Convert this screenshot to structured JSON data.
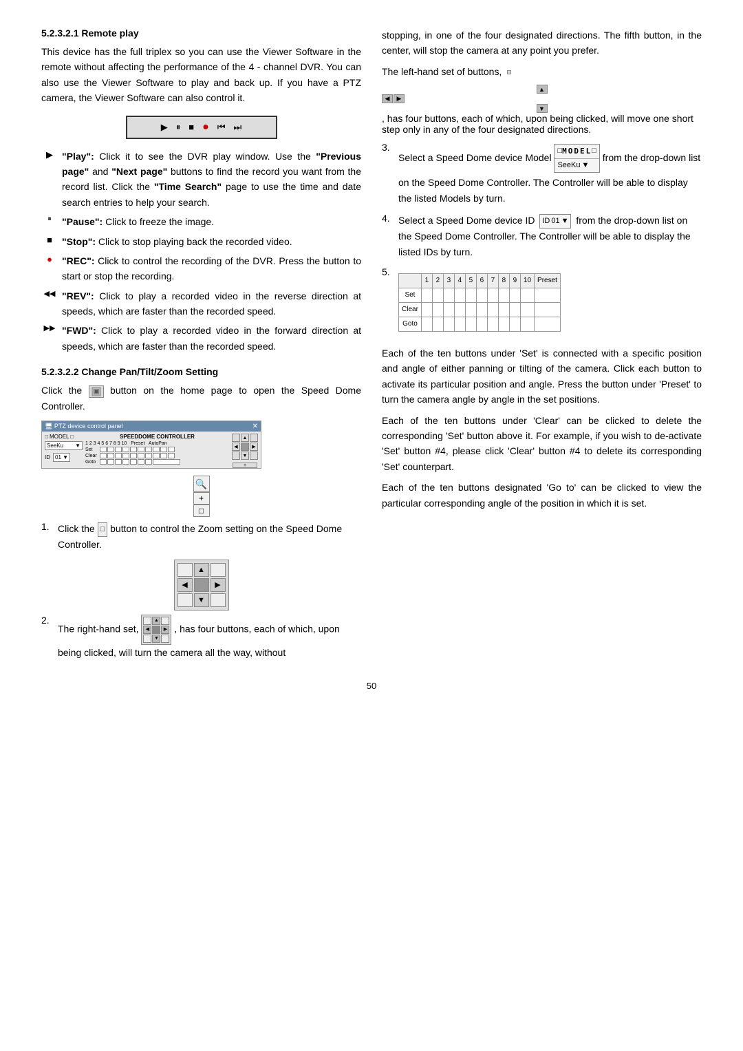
{
  "page": {
    "number": "50"
  },
  "left": {
    "section1": {
      "heading": "5.2.3.2.1 Remote play",
      "para1": "This device has the full triplex so you can use the Viewer Software in the remote without affecting the performance of the 4 - channel DVR. You can also use the Viewer Software to play and back up. If you have a PTZ camera, the Viewer Software can also control it.",
      "bullets": [
        {
          "icon": "▶",
          "text_bold": "\"Play\":",
          "text": " Click it to see the DVR play window. Use the ",
          "bold2": "\"Previous page\"",
          "text2": " and ",
          "bold3": "\"Next page\"",
          "text3": " buttons to find the record you want from the record list. Click the ",
          "bold4": "\"Time Search\"",
          "text4": " page to use the time and date search entries to help your search."
        },
        {
          "icon": "⏸",
          "text_bold": "\"Pause\":",
          "text": " Click to freeze the image."
        },
        {
          "icon": "■",
          "text_bold": "\"Stop\":",
          "text": " Click to stop playing back the recorded video."
        },
        {
          "icon": "●",
          "text_bold": "\"REC\":",
          "text": " Click to control the recording of the DVR. Press the button to start or stop the recording."
        },
        {
          "icon": "«",
          "text_bold": "\"REV\":",
          "text": " Click to play a recorded video in the reverse direction at speeds, which are faster than the recorded speed."
        },
        {
          "icon": "»",
          "text_bold": "\"FWD\":",
          "text": " Click to play a recorded video in the forward direction at speeds, which are faster than the recorded speed."
        }
      ]
    },
    "section2": {
      "heading": "5.2.3.2.2 Change Pan/Tilt/Zoom Setting",
      "para1": "Click the  button on the home page to open the Speed Dome Controller.",
      "zoom_labels": [
        "🔍",
        "+",
        "−"
      ],
      "list": [
        {
          "num": "1.",
          "text": " button to control the Zoom setting on the Speed Dome Controller.",
          "prefix": "Click the"
        },
        {
          "num": "2.",
          "text": ", has four buttons, each of which, upon being clicked, will turn the camera all the way, without",
          "prefix": "The right-hand set,"
        }
      ]
    }
  },
  "right": {
    "para_stop": "stopping, in one of the four designated directions. The fifth button, in the center, will stop the camera at any point you prefer.",
    "para_lefthand": "The left-hand set of buttons,",
    "para_lefthand2": ", has four buttons, each of which, upon being clicked, will move one short step only in any of the four designated directions.",
    "list": [
      {
        "num": "3.",
        "text": "Select a Speed Dome device Model",
        "after": "from the drop-down list on the Speed Dome Controller. The Controller will be able to display the listed Models by turn."
      },
      {
        "num": "4.",
        "text": "Select a Speed Dome device ID",
        "after": "from the drop-down list on the Speed Dome Controller. The Controller will be able to display the listed IDs by turn."
      },
      {
        "num": "5.",
        "text": ""
      }
    ],
    "preset_description1": "Each of the ten buttons under 'Set' is connected with a specific position and angle of either panning or tilting of the camera. Click each button to activate its particular position and angle. Press the button under 'Preset' to turn the camera angle by angle in the set positions.",
    "preset_description2": "Each of the ten buttons under 'Clear' can be clicked to delete the corresponding 'Set' button above it. For example, if you wish to de-activate 'Set' button #4, please click 'Clear' button #4 to delete its corresponding 'Set' counterpart.",
    "preset_description3": "Each of the ten buttons designated 'Go to' can be clicked to view the particular corresponding angle of the position in which it is set.",
    "model_label": "MODEL",
    "seeku_label": "SeeKu",
    "id_label": "ID",
    "id_value": "01",
    "preset_col_headers": [
      "1",
      "2",
      "3",
      "4",
      "5",
      "6",
      "7",
      "8",
      "9",
      "10",
      "Preset"
    ],
    "preset_rows": [
      "Set",
      "Clear",
      "Goto"
    ]
  }
}
